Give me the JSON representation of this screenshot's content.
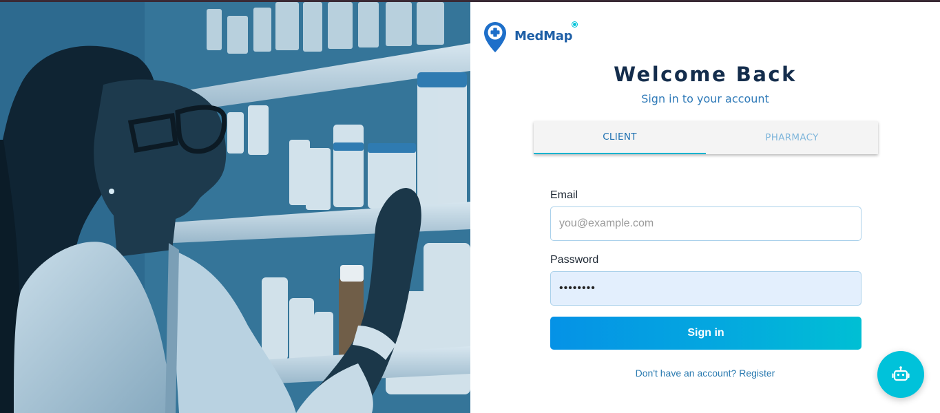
{
  "brand": {
    "name": "MedMap",
    "accent": "#1e5fa6",
    "dot_color": "#00c3d9"
  },
  "heading": {
    "title": "Welcome Back",
    "subtitle": "Sign in to your account"
  },
  "tabs": [
    {
      "label": "CLIENT",
      "active": true
    },
    {
      "label": "PHARMACY",
      "active": false
    }
  ],
  "form": {
    "email_label": "Email",
    "email_placeholder": "you@example.com",
    "email_value": "",
    "password_label": "Password",
    "password_value": "password",
    "submit_label": "Sign in"
  },
  "footer": {
    "prompt": "Don't have an account?",
    "register_link": "Register"
  },
  "hero": {
    "icon": "pharmacist-photo",
    "tint": "#2b6489"
  },
  "chat": {
    "icon": "robot-icon",
    "color": "#00c2da"
  }
}
